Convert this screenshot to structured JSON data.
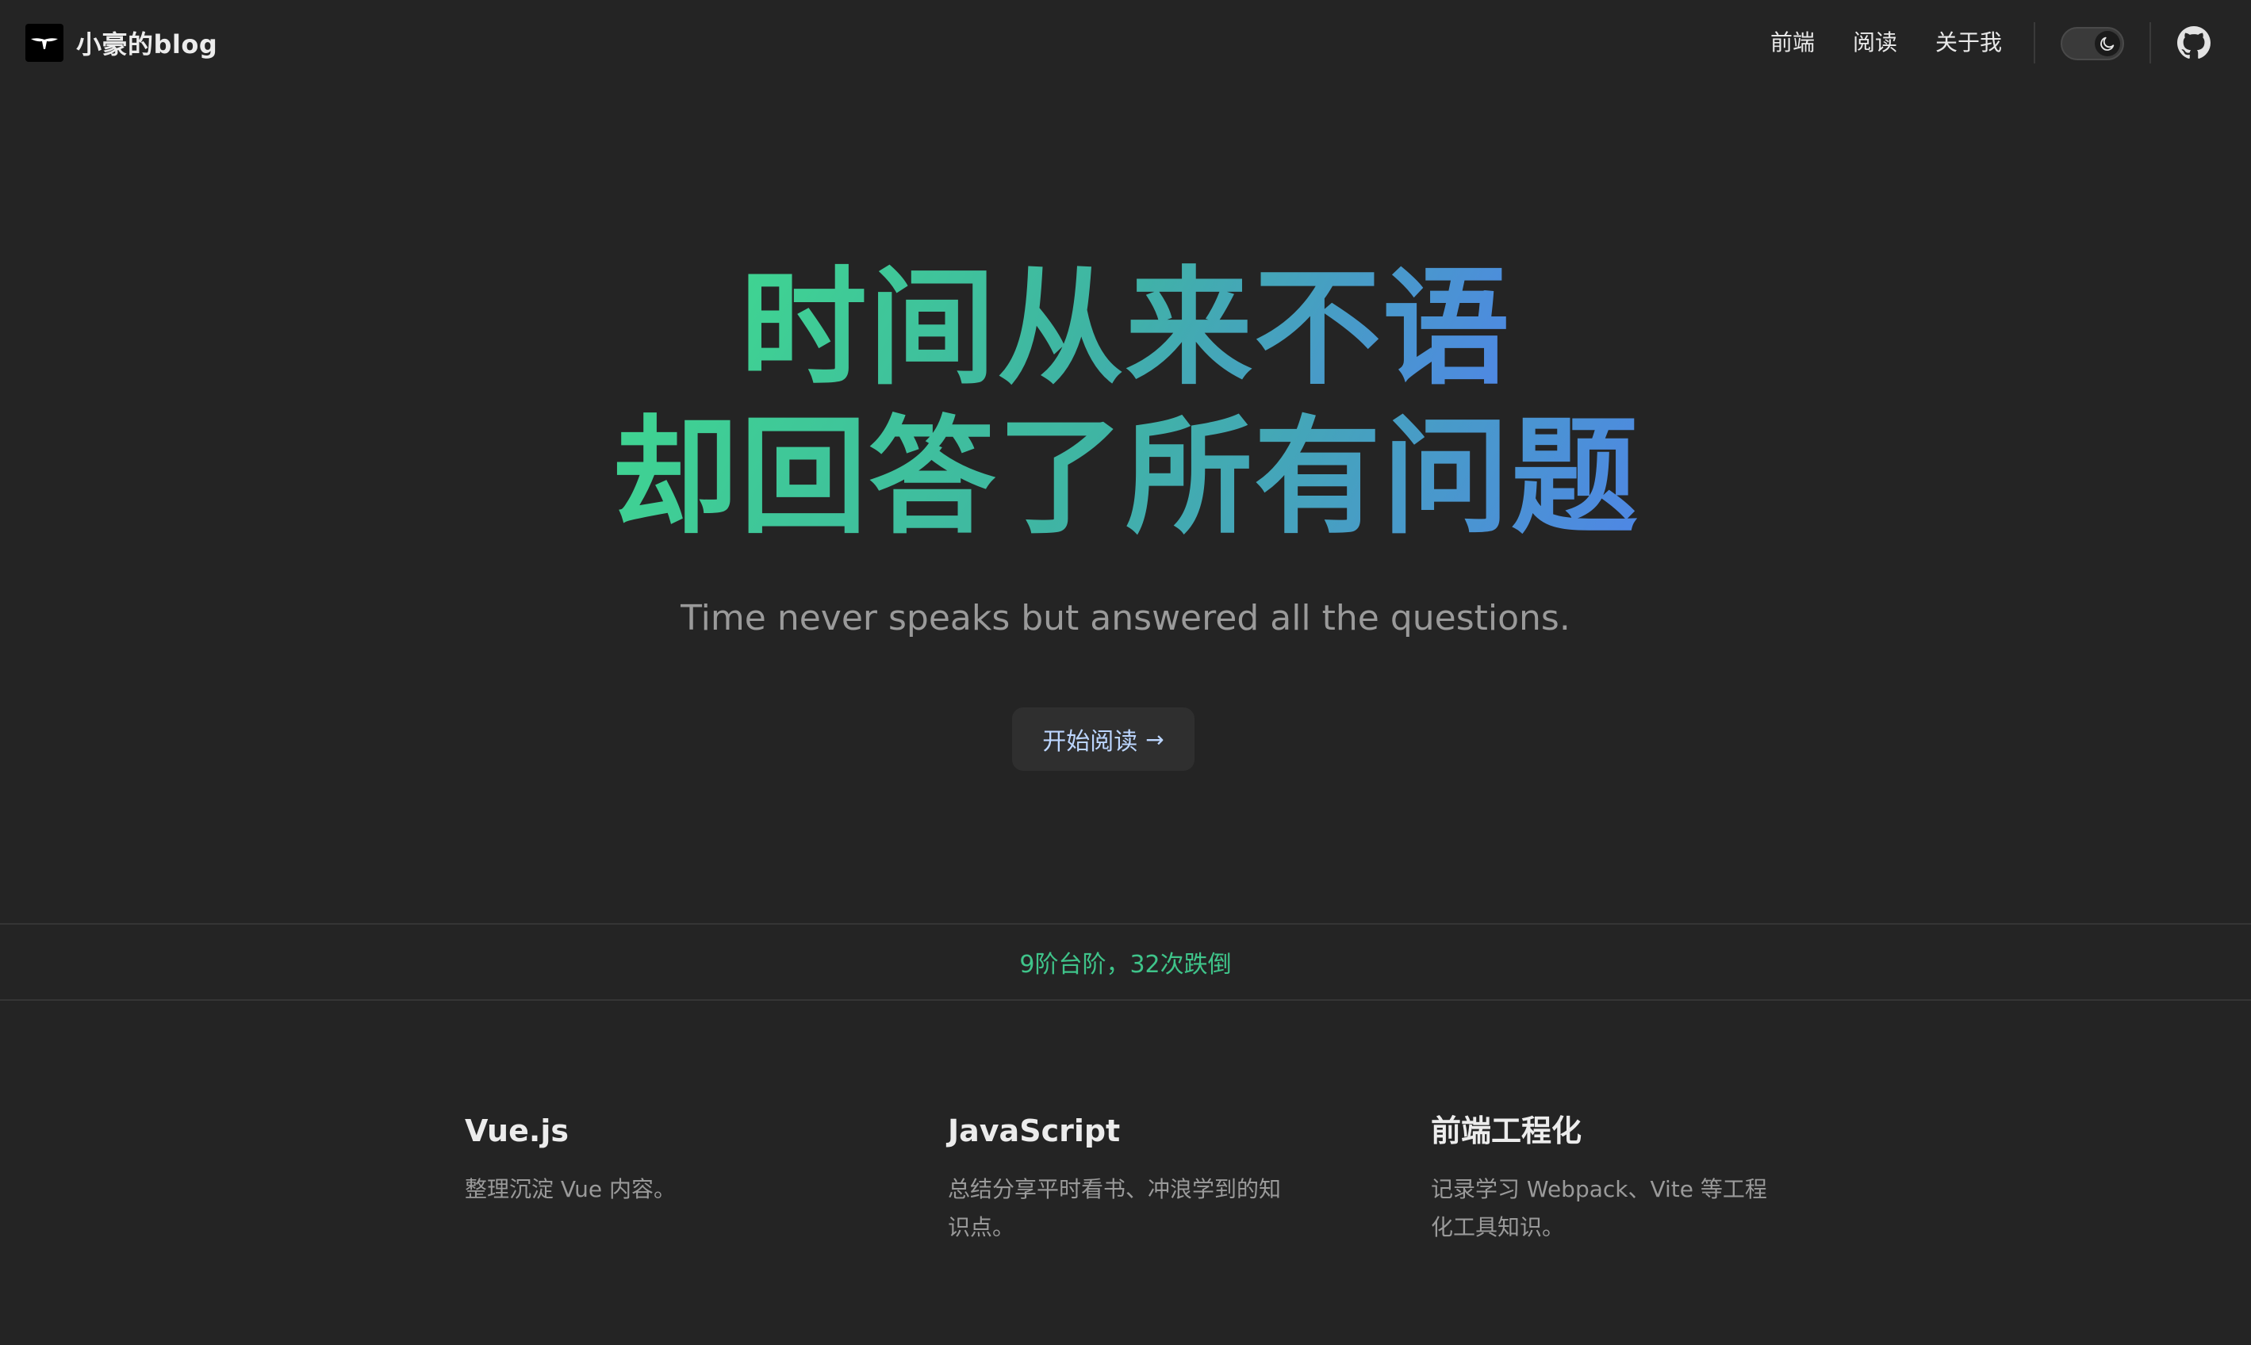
{
  "header": {
    "brand_title": "小豪的blog",
    "nav": [
      {
        "label": "前端"
      },
      {
        "label": "阅读"
      },
      {
        "label": "关于我"
      }
    ],
    "theme_toggle_icon": "moon-icon",
    "github_icon": "github-icon"
  },
  "hero": {
    "title_line1": "时间从来不语",
    "title_line2": "却回答了所有问题",
    "tagline": "Time never speaks but answered all the questions.",
    "cta_label": "开始阅读",
    "cta_arrow": "→",
    "gradient_from": "#3fd591",
    "gradient_to": "#4f86e6"
  },
  "stats": {
    "text": "9阶台阶，32次跌倒",
    "color": "#3fc48a"
  },
  "features": [
    {
      "title": "Vue.js",
      "desc": "整理沉淀 Vue 内容。"
    },
    {
      "title": "JavaScript",
      "desc": "总结分享平时看书、冲浪学到的知识点。"
    },
    {
      "title": "前端工程化",
      "desc": "记录学习 Webpack、Vite 等工程化工具知识。"
    }
  ],
  "colors": {
    "background": "#242424",
    "text_primary": "#ececec",
    "text_muted": "#9a9a9a",
    "button_bg": "#2f2f2f",
    "button_text": "#bcd6ff"
  }
}
